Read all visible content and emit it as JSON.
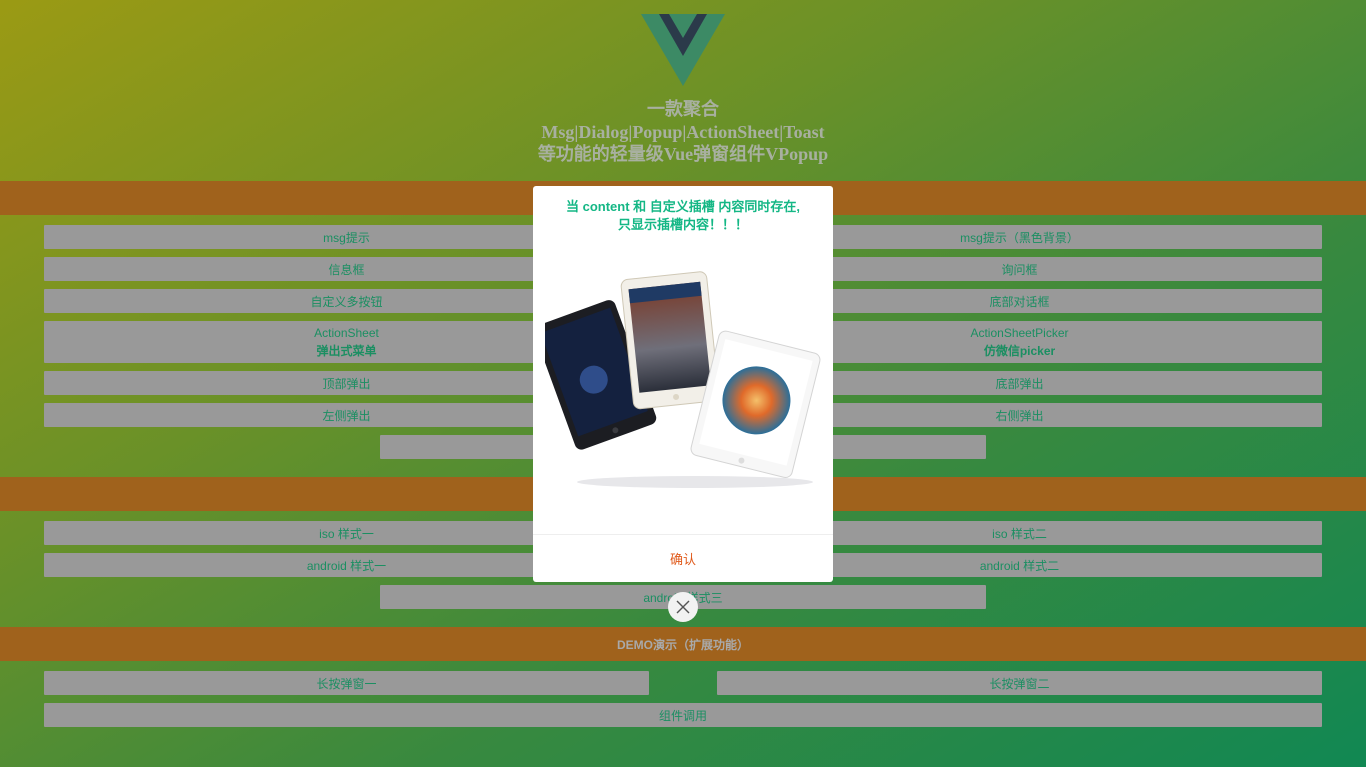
{
  "header": {
    "title_lines": [
      "一款聚合",
      "Msg|Dialog|Popup|ActionSheet|Toast",
      "等功能的轻量级Vue弹窗组件VPopup"
    ]
  },
  "sections": [
    {
      "buttons": [
        {
          "label": "msg提示"
        },
        {
          "label": "msg提示（黑色背景）"
        },
        {
          "label": "信息框"
        },
        {
          "label": "询问框"
        },
        {
          "label": "自定义多按钮"
        },
        {
          "label": "底部对话框"
        },
        {
          "label": "ActionSheet",
          "sub": "弹出式菜单"
        },
        {
          "label": "ActionSheetPicker",
          "sub": "仿微信picker"
        },
        {
          "label": "顶部弹出"
        },
        {
          "label": "底部弹出"
        },
        {
          "label": "左侧弹出"
        },
        {
          "label": "右侧弹出"
        }
      ]
    },
    {
      "buttons": [
        {
          "label": "iso 样式一"
        },
        {
          "label": "iso 样式二"
        },
        {
          "label": "android 样式一"
        },
        {
          "label": "android 样式二"
        },
        {
          "label": "android 样式三"
        }
      ]
    },
    {
      "title": "DEMO演示（扩展功能）",
      "buttons": [
        {
          "label": "长按弹窗一"
        },
        {
          "label": "长按弹窗二"
        },
        {
          "label": "组件调用"
        }
      ]
    }
  ],
  "dialog": {
    "content_lines": [
      "当 content 和 自定义插槽 内容同时存在,",
      "只显示插槽内容！！！"
    ],
    "image": "ipad-mini-tablets-image",
    "confirm_label": "确认",
    "close_icon": "close-icon"
  },
  "colors": {
    "band": "#a0621c",
    "button_bg": "#999999",
    "button_text": "#1b8f62",
    "dialog_text": "#14b785",
    "confirm_text": "#e05a1b"
  }
}
